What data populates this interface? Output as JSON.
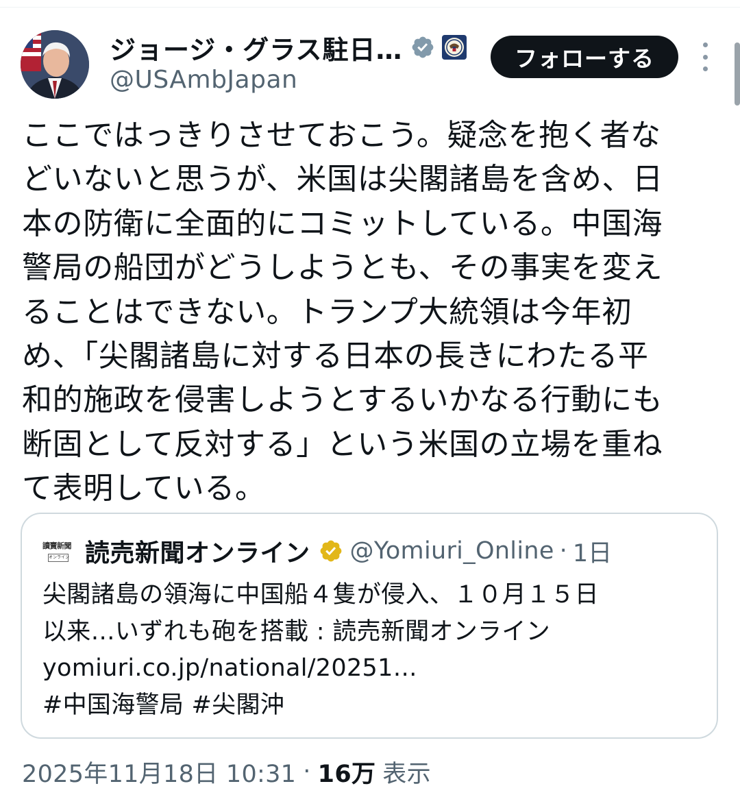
{
  "tweet": {
    "author": {
      "display_name": "ジョージ・グラス駐日…",
      "handle": "@USAmbJapan",
      "verified_icon": "verified-badge-gray",
      "affiliation_icon": "state-department-seal"
    },
    "follow_label": "フォローする",
    "text": "ここではっきりさせておこう。疑念を抱く者な\nどいないと思うが、米国は尖閣諸島を含め、日\n本の防衛に全面的にコミットしている。中国海\n警局の船団がどうしようとも、その事実を変え\nることはできない。トランプ大統領は今年初\nめ、「尖閣諸島に対する日本の長きにわたる平\n和的施政を侵害しようとするいかなる行動にも\n断固として反対する」という米国の立場を重ね\nて表明している。",
    "quoted": {
      "avatar_text": "讀賣新聞",
      "avatar_sub": "オンライン",
      "display_name": "読売新聞オンライン",
      "verified_icon": "verified-badge-gold",
      "handle": "@Yomiuri_Online",
      "separator": "·",
      "time": "1日",
      "text": "尖閣諸島の領海に中国船４隻が侵入、１０月１５日\n以来…いずれも砲を搭載 : 読売新聞オンライン\nyomiuri.co.jp/national/20251…\n#中国海警局 #尖閣沖"
    },
    "meta": {
      "timestamp": "2025年11月18日 10:31",
      "separator": "·",
      "views_count": "16万",
      "views_label": "表示"
    }
  },
  "colors": {
    "text_primary": "#0f1419",
    "text_secondary": "#536471",
    "border": "#cfd9de",
    "follow_bg": "#0f1419",
    "verified_gray": "#829aab",
    "verified_gold": "#e2b719"
  }
}
